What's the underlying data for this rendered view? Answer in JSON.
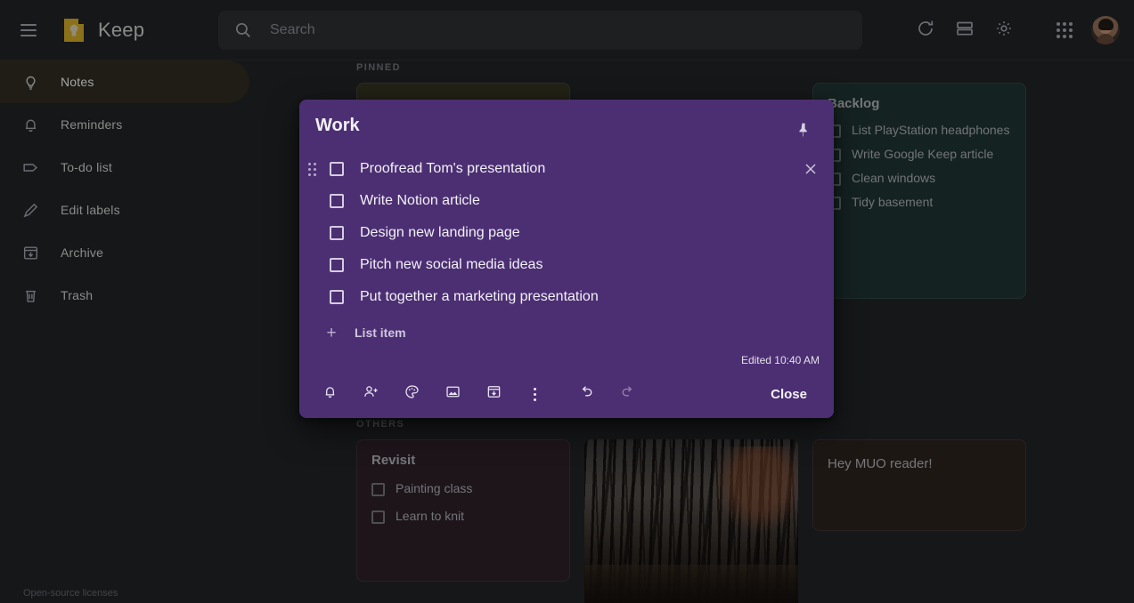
{
  "app": {
    "brand_title": "Keep",
    "logo_icon": "keep-logo-icon",
    "menu_icon": "hamburger-menu-icon",
    "licenses_label": "Open-source licenses",
    "accent_purple": "#4c2f72",
    "bg_color": "#202124"
  },
  "search": {
    "placeholder": "Search",
    "value": "",
    "icon": "search-icon"
  },
  "header_actions": [
    {
      "name": "refresh-button",
      "icon": "refresh-icon",
      "label": "Refresh"
    },
    {
      "name": "list-view-button",
      "icon": "list-view-icon",
      "label": "List view"
    },
    {
      "name": "settings-button",
      "icon": "gear-icon",
      "label": "Settings"
    },
    {
      "name": "google-apps-button",
      "icon": "apps-grid-icon",
      "label": "Google apps"
    },
    {
      "name": "account-avatar",
      "icon": "avatar-icon",
      "label": "Google Account"
    }
  ],
  "sidebar": {
    "items": [
      {
        "label": "Notes",
        "icon": "lightbulb-icon",
        "active": true
      },
      {
        "label": "Reminders",
        "icon": "bell-icon",
        "active": false
      },
      {
        "label": "To-do list",
        "icon": "label-tag-icon",
        "active": false
      },
      {
        "label": "Edit labels",
        "icon": "pencil-icon",
        "active": false
      },
      {
        "label": "Archive",
        "icon": "archive-icon",
        "active": false
      },
      {
        "label": "Trash",
        "icon": "trash-icon",
        "active": false
      }
    ]
  },
  "sections": {
    "pinned_label": "PINNED",
    "others_label": "OTHERS"
  },
  "notes": {
    "pinned_olive": {
      "title": "",
      "color": "#32301f"
    },
    "backlog": {
      "title": "Backlog",
      "color": "#1e3230",
      "items": [
        "List PlayStation headphones",
        "Write Google Keep article",
        "Clean windows",
        "Tidy basement"
      ]
    },
    "revisit": {
      "title": "Revisit",
      "color": "#2c1f28",
      "items": [
        "Painting class",
        "Learn to knit"
      ]
    },
    "photo": {
      "alt": "Forest photo note"
    },
    "muo": {
      "body": "Hey MUO reader!",
      "color": "#2a211e"
    }
  },
  "modal": {
    "title": "Work",
    "pin_icon": "pin-filled-icon",
    "pin_label": "Unpin note",
    "items": [
      {
        "text": "Proofread Tom's presentation",
        "checked": false,
        "handle": true,
        "remove": true
      },
      {
        "text": "Write Notion article",
        "checked": false,
        "handle": false,
        "remove": false
      },
      {
        "text": "Design new landing page",
        "checked": false,
        "handle": false,
        "remove": false
      },
      {
        "text": "Pitch new social media ideas",
        "checked": false,
        "handle": false,
        "remove": false
      },
      {
        "text": "Put together a marketing presentation",
        "checked": false,
        "handle": false,
        "remove": false
      }
    ],
    "add_item_label": "List item",
    "edited_label": "Edited 10:40 AM",
    "close_label": "Close",
    "footer_actions": [
      {
        "name": "remind-me-button",
        "icon": "bell-icon",
        "label": "Remind me"
      },
      {
        "name": "collaborator-button",
        "icon": "person-add-icon",
        "label": "Collaborator"
      },
      {
        "name": "background-options-button",
        "icon": "palette-icon",
        "label": "Background options"
      },
      {
        "name": "add-image-button",
        "icon": "image-icon",
        "label": "Add image"
      },
      {
        "name": "archive-button",
        "icon": "archive-icon",
        "label": "Archive"
      },
      {
        "name": "more-options-button",
        "icon": "more-vertical-icon",
        "label": "More"
      },
      {
        "name": "undo-button",
        "icon": "undo-icon",
        "label": "Undo"
      },
      {
        "name": "redo-button",
        "icon": "redo-icon",
        "label": "Redo"
      }
    ]
  }
}
